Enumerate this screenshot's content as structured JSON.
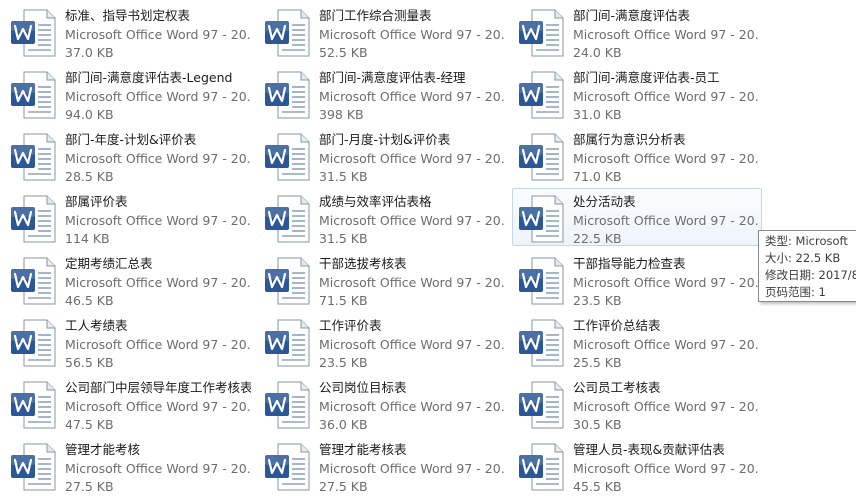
{
  "files": [
    {
      "name": "标准、指导书划定权表",
      "type": "Microsoft Office Word 97 - 20...",
      "size": "37.0 KB"
    },
    {
      "name": "部门工作综合测量表",
      "type": "Microsoft Office Word 97 - 20...",
      "size": "52.5 KB"
    },
    {
      "name": "部门间-满意度评估表",
      "type": "Microsoft Office Word 97 - 20...",
      "size": "24.0 KB"
    },
    {
      "name": "部门间-满意度评估表-Legend",
      "type": "Microsoft Office Word 97 - 20...",
      "size": "94.0 KB"
    },
    {
      "name": "部门间-满意度评估表-经理",
      "type": "Microsoft Office Word 97 - 20...",
      "size": "398 KB"
    },
    {
      "name": "部门间-满意度评估表-员工",
      "type": "Microsoft Office Word 97 - 20...",
      "size": "31.0 KB"
    },
    {
      "name": "部门-年度-计划&评价表",
      "type": "Microsoft Office Word 97 - 20...",
      "size": "28.5 KB"
    },
    {
      "name": "部门-月度-计划&评价表",
      "type": "Microsoft Office Word 97 - 20...",
      "size": "31.5 KB"
    },
    {
      "name": "部属行为意识分析表",
      "type": "Microsoft Office Word 97 - 20...",
      "size": "71.0 KB"
    },
    {
      "name": "部属评价表",
      "type": "Microsoft Office Word 97 - 20...",
      "size": "114 KB"
    },
    {
      "name": "成绩与效率评估表格",
      "type": "Microsoft Office Word 97 - 20...",
      "size": "31.5 KB"
    },
    {
      "name": "处分活动表",
      "type": "Microsoft Office Word 97 - 20...",
      "size": "22.5 KB"
    },
    {
      "name": "定期考绩汇总表",
      "type": "Microsoft Office Word 97 - 20...",
      "size": "46.5 KB"
    },
    {
      "name": "干部选拔考核表",
      "type": "Microsoft Office Word 97 - 20...",
      "size": "71.5 KB"
    },
    {
      "name": "干部指导能力检查表",
      "type": "Microsoft Office Word 97 - 20...",
      "size": "23.5 KB"
    },
    {
      "name": "工人考绩表",
      "type": "Microsoft Office Word 97 - 20...",
      "size": "56.5 KB"
    },
    {
      "name": "工作评价表",
      "type": "Microsoft Office Word 97 - 20...",
      "size": "23.5 KB"
    },
    {
      "name": "工作评价总结表",
      "type": "Microsoft Office Word 97 - 20...",
      "size": "25.5 KB"
    },
    {
      "name": "公司部门中层领导年度工作考核表",
      "type": "Microsoft Office Word 97 - 20...",
      "size": "47.5 KB"
    },
    {
      "name": "公司岗位目标表",
      "type": "Microsoft Office Word 97 - 20...",
      "size": "36.0 KB"
    },
    {
      "name": "公司员工考核表",
      "type": "Microsoft Office Word 97 - 20...",
      "size": "30.5 KB"
    },
    {
      "name": "管理才能考核",
      "type": "Microsoft Office Word 97 - 20...",
      "size": "27.5 KB"
    },
    {
      "name": "管理才能考核表",
      "type": "Microsoft Office Word 97 - 20...",
      "size": "27.5 KB"
    },
    {
      "name": "管理人员-表现&贡献评估表",
      "type": "Microsoft Office Word 97 - 20...",
      "size": "45.5 KB"
    }
  ],
  "tooltip": {
    "type_line": "类型: Microsoft",
    "size_line": "大小: 22.5 KB",
    "date_line": "修改日期: 2017/8",
    "pages_line": "页码范围: 1"
  },
  "icon": {
    "name": "word-document-icon",
    "color": "#2b5797"
  }
}
